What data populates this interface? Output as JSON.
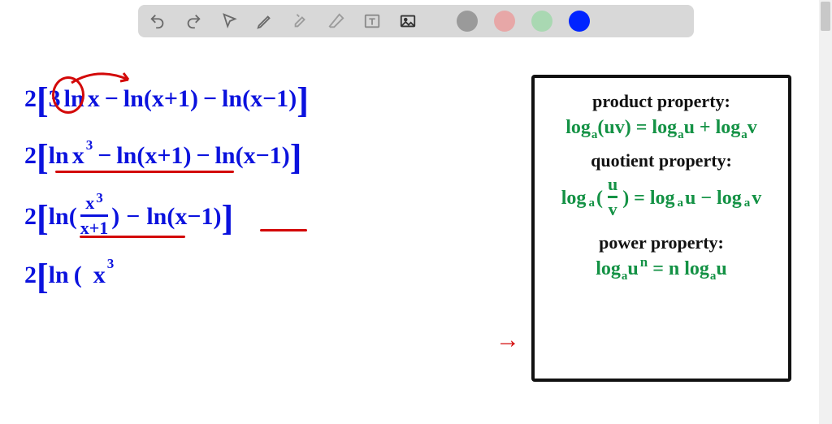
{
  "toolbar": {
    "icons": [
      "undo",
      "redo",
      "pointer",
      "pencil",
      "tools",
      "eraser",
      "textbox",
      "image"
    ],
    "swatches": [
      "#9a9a9a",
      "#e7a7a7",
      "#a9d8b2",
      "#0024ff"
    ]
  },
  "math": {
    "two": "2",
    "lb": "[",
    "rb": "]",
    "three": "3",
    "ln": "ln",
    "x": "x",
    "minus": "−",
    "lp": "(",
    "rp": ")",
    "xp1": "x+1",
    "xm1": "x−1",
    "cube": "3",
    "frac_num": "x",
    "frac_den": "x+1"
  },
  "hints": {
    "title1": "product property:",
    "eq1a": "log",
    "eq1b": "a",
    "eq1c": "(uv) = log",
    "eq1d": "a",
    "eq1e": "u + log",
    "eq1f": "a",
    "eq1g": "v",
    "title2": "quotient property:",
    "eq2a": "log",
    "eq2b": "a",
    "eq2c_open": "(",
    "eq2_num": "u",
    "eq2_den": "v",
    "eq2c_close": ") = log",
    "eq2d": "a",
    "eq2e": "u − log",
    "eq2f": "a",
    "eq2g": "v",
    "title3": "power property:",
    "eq3a": "log",
    "eq3b": "a",
    "eq3c": "u",
    "eq3n": "n",
    "eq3d": " = n log",
    "eq3e": "a",
    "eq3f": "u"
  },
  "arrow": "→"
}
